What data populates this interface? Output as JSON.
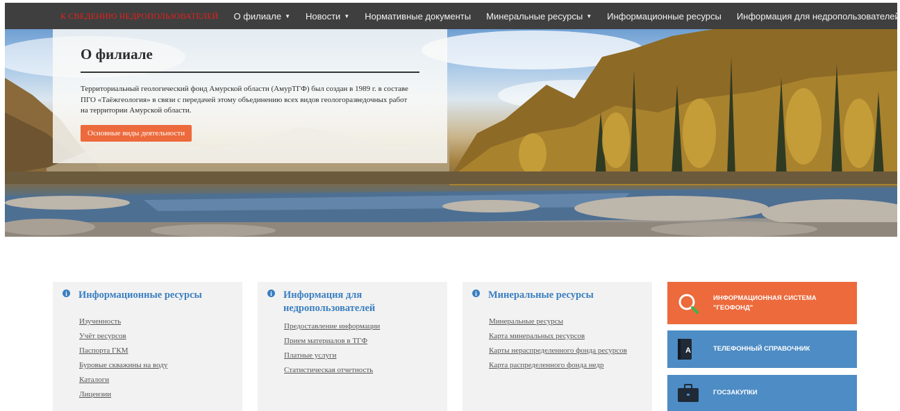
{
  "nav": {
    "alert": "К СВЕДЕНИЮ НЕДРОПОЛЬЗОВАТЕЛЕЙ",
    "items": [
      {
        "label": "О филиале",
        "caret": "▼"
      },
      {
        "label": "Новости",
        "caret": "▼"
      },
      {
        "label": "Нормативные документы",
        "caret": ""
      },
      {
        "label": "Минеральные ресурсы",
        "caret": "▼"
      },
      {
        "label": "Информационные ресурсы",
        "caret": ""
      },
      {
        "label": "Информация для недропользователей",
        "caret": ""
      }
    ]
  },
  "hero": {
    "title": "О филиале",
    "text": "Территориальный геологический фонд Амурской области (АмурТГФ) был создан в 1989 г. в составе ПГО «Таёжгеология» в связи с передачей этому объединению всех видов геологоразведочных работ на территории Амурской области.",
    "button": "Основные виды деятельности"
  },
  "panels": [
    {
      "title": "Информационные ресурсы",
      "icon": "info-icon",
      "links": [
        "Изученность",
        "Учёт ресурсов",
        "Паспорта ГКМ",
        "Буровые скважины на воду",
        "Каталоги",
        "Лицензии"
      ]
    },
    {
      "title": "Информация для недропользователей",
      "icon": "info-icon",
      "links": [
        "Предоставление информации",
        "Прием материалов в ТГФ",
        "Платные услуги",
        "Статистическая отчетность"
      ]
    },
    {
      "title": "Минеральные ресурсы",
      "icon": "info-icon",
      "links": [
        "Минеральные ресурсы",
        "Карта минеральных ресурсов",
        "Карты нераспределенного фонда ресурсов",
        "Карта распределенного фонда недр"
      ]
    }
  ],
  "tiles": [
    {
      "label": "ИНФОРМАЦИОННАЯ СИСТЕМА \"ГЕОФОНД\"",
      "icon": "search-icon",
      "color": "#ec6a3c"
    },
    {
      "label": "ТЕЛЕФОННЫЙ СПРАВОЧНИК",
      "icon": "phone-book-icon",
      "color": "#4d8cc4"
    },
    {
      "label": "ГОСЗАКУПКИ",
      "icon": "briefcase-icon",
      "color": "#4d8cc4"
    }
  ],
  "colors": {
    "nav_bg": "#3f3f3f",
    "alert": "#e8201e",
    "accent_orange": "#ec6a3c",
    "accent_blue": "#4d8cc4",
    "panel_bg": "#f2f2f2",
    "link_title": "#3a7fc0"
  }
}
